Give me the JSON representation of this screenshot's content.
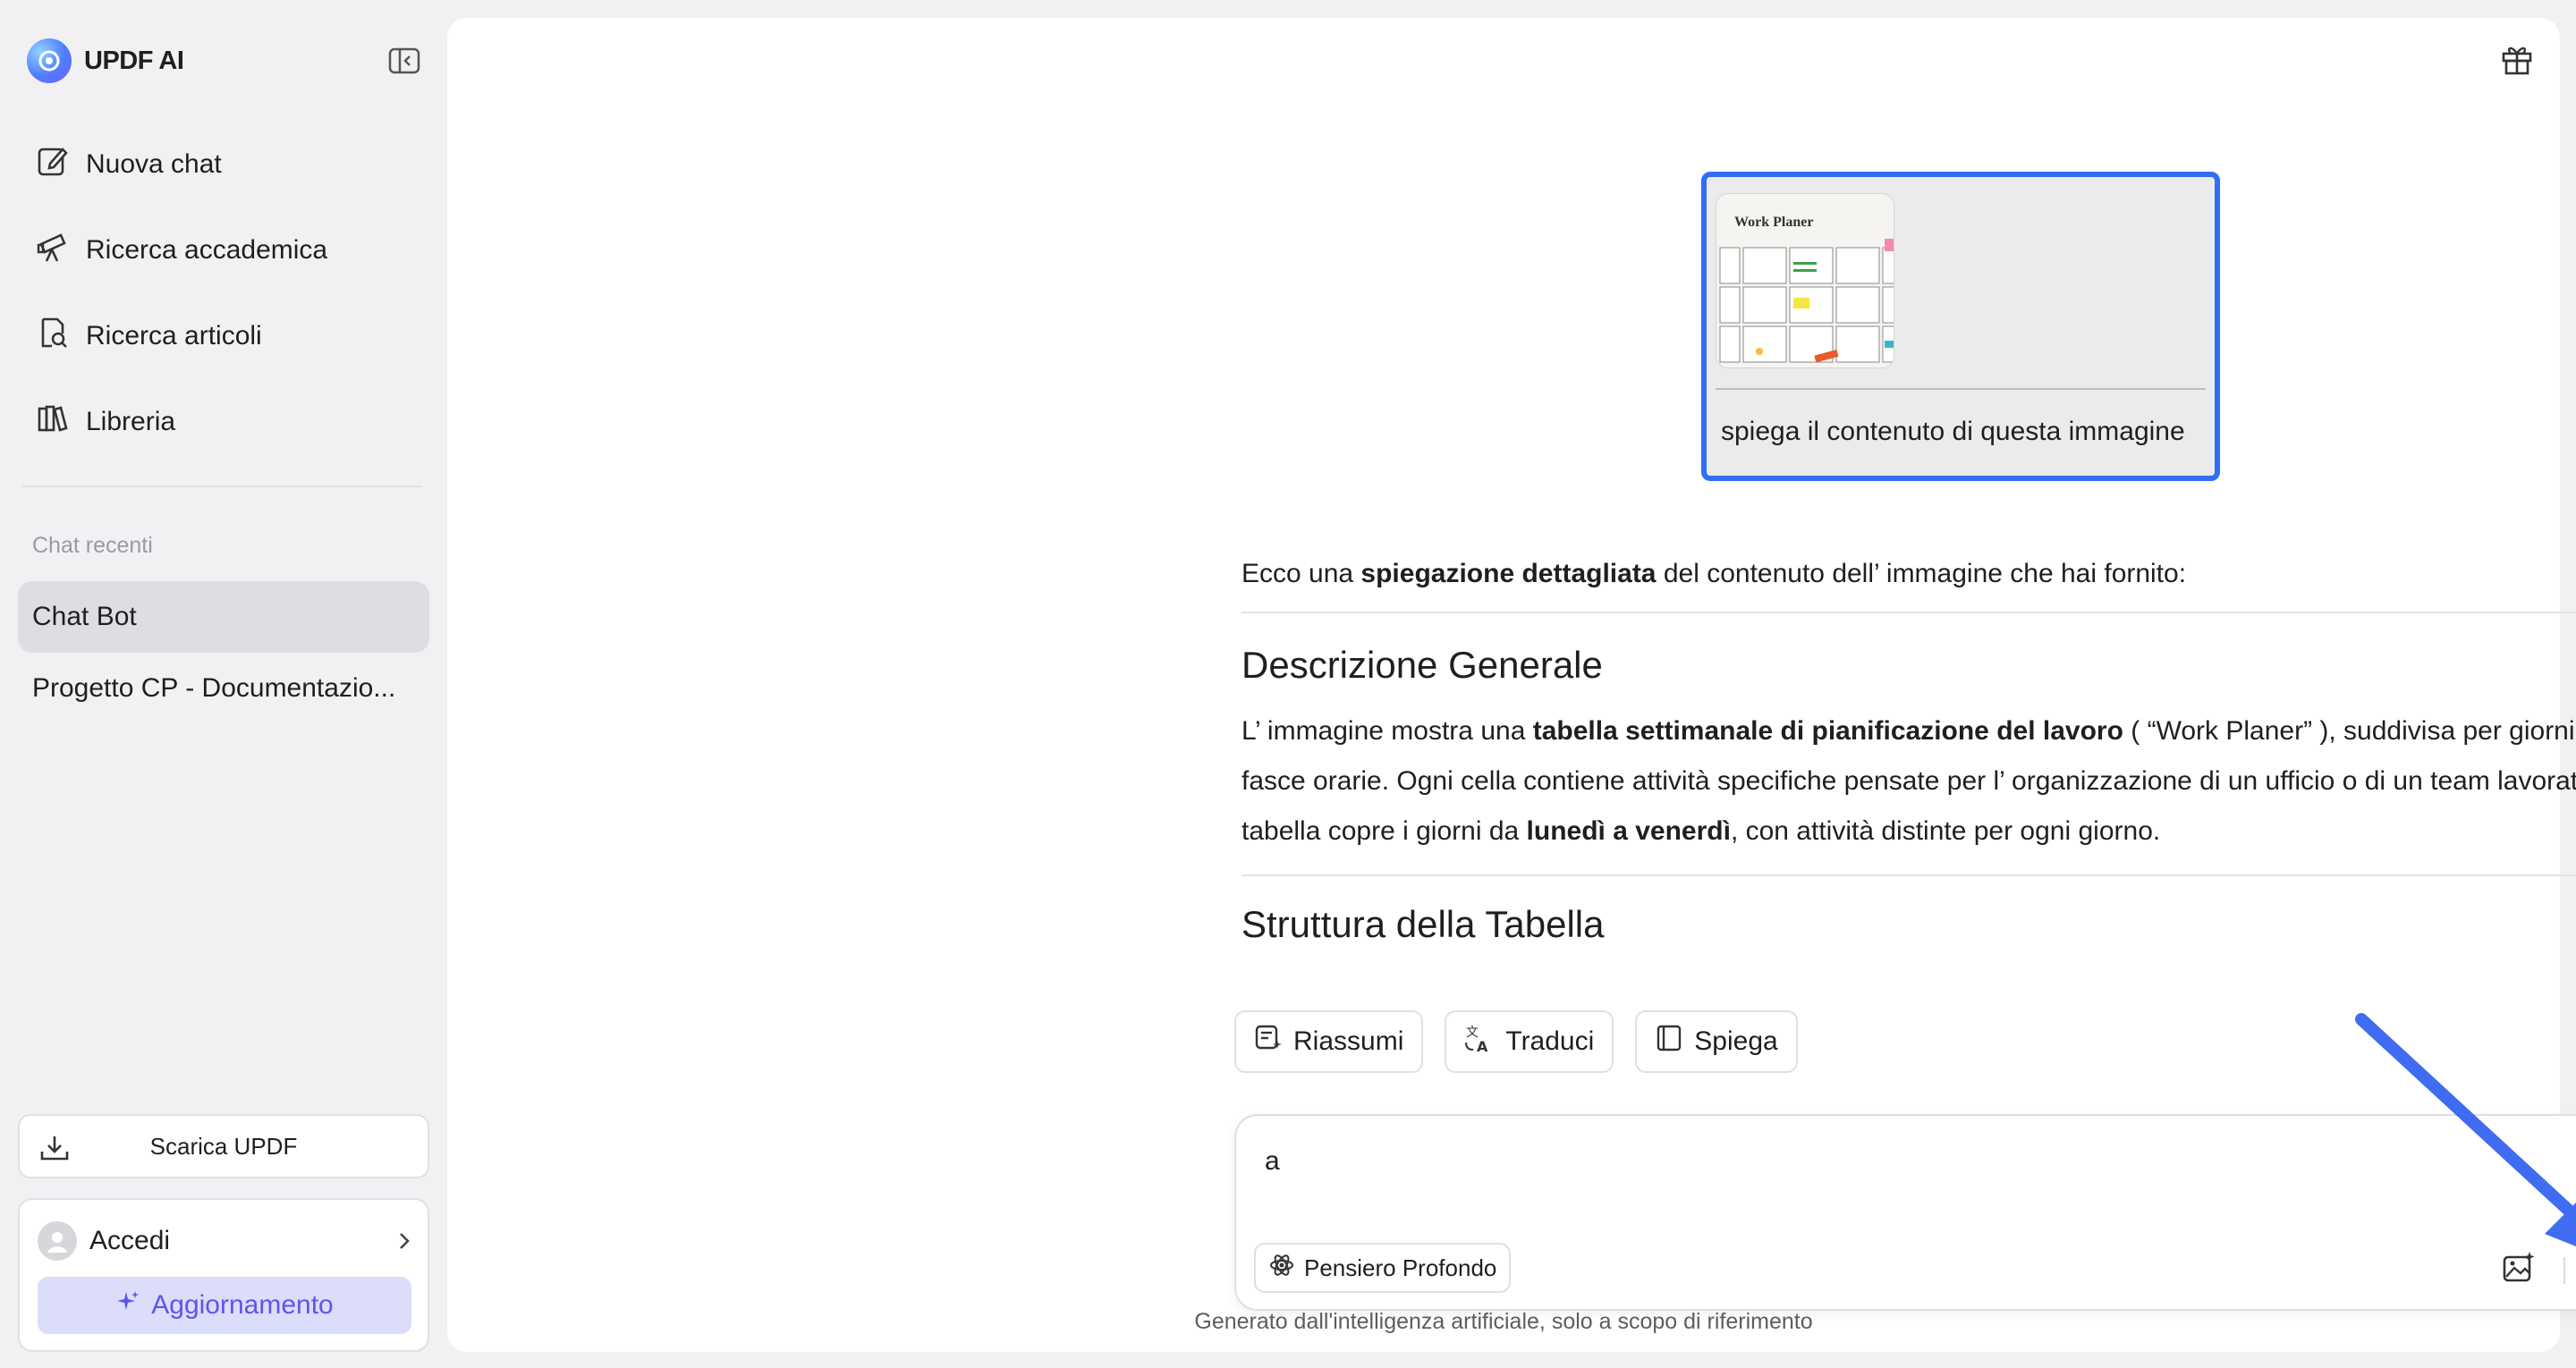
{
  "app": {
    "name": "UPDF AI"
  },
  "sidebar": {
    "nav": [
      {
        "label": "Nuova chat",
        "icon": "edit-icon"
      },
      {
        "label": "Ricerca accademica",
        "icon": "telescope-icon"
      },
      {
        "label": "Ricerca articoli",
        "icon": "document-search-icon"
      },
      {
        "label": "Libreria",
        "icon": "library-icon"
      }
    ],
    "recent_label": "Chat recenti",
    "recent": [
      "Chat Bot",
      "Progetto CP - Documentazio..."
    ],
    "download_label": "Scarica UPDF",
    "login_label": "Accedi",
    "upgrade_label": "Aggiornamento"
  },
  "chat": {
    "user_message": "spiega il contenuto di questa immagine",
    "thumbnail_title": "Work Planer",
    "answer": {
      "intro_a": "Ecco una ",
      "intro_b": "spiegazione dettagliata",
      "intro_c": " del contenuto dell’ immagine che hai fornito:",
      "h1": "Descrizione Generale",
      "p1_a": "L’ immagine mostra una ",
      "p1_b": "tabella settimanale di pianificazione del lavoro",
      "p1_c": " ( “Work Planer” ), suddivisa per giorni e fasce orarie. Ogni cella contiene attività specifiche pensate per l’ organizzazione di un ufficio o di un team lavorativo. La tabella copre i giorni da ",
      "p1_d": "lunedì a venerdì",
      "p1_e": ", con attività distinte per ogni giorno.",
      "h2": "Struttura della Tabella"
    }
  },
  "actions": {
    "summarize": "Riassumi",
    "translate": "Traduci",
    "explain": "Spiega"
  },
  "composer": {
    "value": "a",
    "deep_think_label": "Pensiero Profondo"
  },
  "footer": "Generato dall'intelligenza artificiale, solo a scopo di riferimento",
  "colors": {
    "accent": "#6b6cf6",
    "highlight_border": "#2f6ef5",
    "annotation_arrow": "#3f6cf0"
  }
}
